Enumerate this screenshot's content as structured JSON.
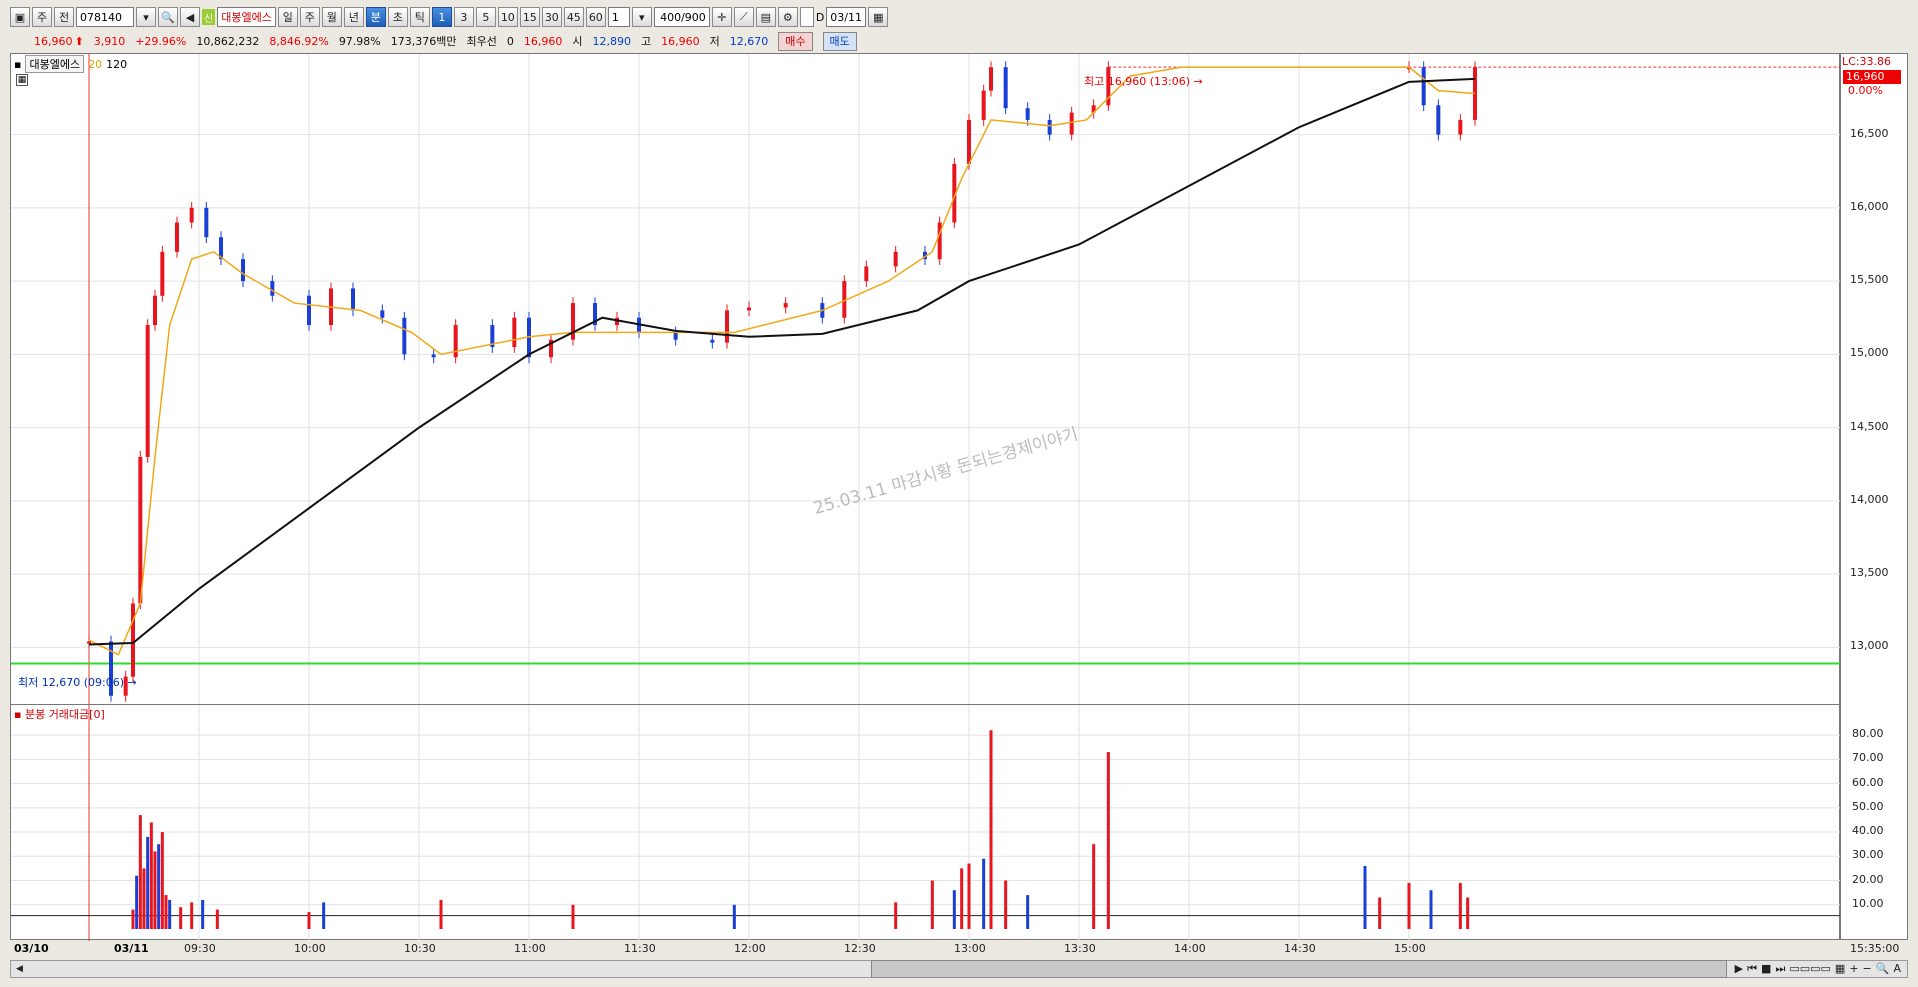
{
  "toolbar": {
    "type_label": "주",
    "prefix": "전",
    "code": "078140",
    "shin": "신",
    "name": "대봉엘에스",
    "period_day": "일",
    "period_week": "주",
    "period_month": "월",
    "period_year": "년",
    "period_min": "분",
    "period_sec": "초",
    "period_tick": "틱",
    "intervals": [
      "1",
      "3",
      "5",
      "10",
      "15",
      "30",
      "45",
      "60"
    ],
    "interval_value": "1",
    "count": "400/900",
    "check_label": "D",
    "date": "03/11"
  },
  "quote": {
    "price": "16,960",
    "change": "3,910",
    "change_pct": "+29.96%",
    "volume": "10,862,232",
    "vol_ratio": "8,846.92%",
    "pct2": "97.98%",
    "amount": "173,376백만",
    "best_label": "최우선",
    "best_value": "0",
    "best_price": "16,960",
    "open_label": "시",
    "open": "12,890",
    "high_label": "고",
    "high": "16,960",
    "low_label": "저",
    "low": "12,670",
    "buy": "매수",
    "sell": "매도"
  },
  "legend": {
    "name": "대봉엘에스",
    "ma20": "20",
    "ma120": "120"
  },
  "annotations": {
    "high": "최고 16,960 (13:06) →",
    "low": "최저 12,670 (09:06) →",
    "lc": "LC:33.86",
    "last": "16,960",
    "pct": "0.00%",
    "watermark": "25.03.11 마감시황 돈되는경제이야기",
    "volume_title": "분봉 거래대금[0]"
  },
  "price_axis": [
    "16,500",
    "16,000",
    "15,500",
    "15,000",
    "14,500",
    "14,000",
    "13,500",
    "13,000"
  ],
  "volume_axis": [
    "80.00",
    "70.00",
    "60.00",
    "50.00",
    "40.00",
    "30.00",
    "20.00",
    "10.00"
  ],
  "time_axis": [
    "09:30",
    "10:00",
    "10:30",
    "11:00",
    "11:30",
    "12:00",
    "12:30",
    "13:00",
    "13:30",
    "14:00",
    "14:30",
    "15:00",
    "15:35:00"
  ],
  "dates": [
    "03/10",
    "03/11"
  ],
  "chart_data": {
    "type": "candlestick",
    "ylim": [
      12600,
      17050
    ],
    "support_line": 12890,
    "price": [
      {
        "t": "09:00",
        "c": 13040
      },
      {
        "t": "09:06",
        "c": 12670
      },
      {
        "t": "09:10",
        "c": 12800
      },
      {
        "t": "09:12",
        "c": 13300
      },
      {
        "t": "09:14",
        "c": 14300
      },
      {
        "t": "09:16",
        "c": 15200
      },
      {
        "t": "09:18",
        "c": 15400
      },
      {
        "t": "09:20",
        "c": 15700
      },
      {
        "t": "09:24",
        "c": 15900
      },
      {
        "t": "09:28",
        "c": 16000
      },
      {
        "t": "09:32",
        "c": 15800
      },
      {
        "t": "09:36",
        "c": 15650
      },
      {
        "t": "09:42",
        "c": 15500
      },
      {
        "t": "09:50",
        "c": 15400
      },
      {
        "t": "10:00",
        "c": 15200
      },
      {
        "t": "10:06",
        "c": 15450
      },
      {
        "t": "10:12",
        "c": 15300
      },
      {
        "t": "10:20",
        "c": 15250
      },
      {
        "t": "10:26",
        "c": 15000
      },
      {
        "t": "10:34",
        "c": 14980
      },
      {
        "t": "10:40",
        "c": 15200
      },
      {
        "t": "10:50",
        "c": 15050
      },
      {
        "t": "10:56",
        "c": 15250
      },
      {
        "t": "11:00",
        "c": 14980
      },
      {
        "t": "11:06",
        "c": 15100
      },
      {
        "t": "11:12",
        "c": 15350
      },
      {
        "t": "11:18",
        "c": 15200
      },
      {
        "t": "11:24",
        "c": 15250
      },
      {
        "t": "11:30",
        "c": 15150
      },
      {
        "t": "11:40",
        "c": 15100
      },
      {
        "t": "11:50",
        "c": 15080
      },
      {
        "t": "11:54",
        "c": 15300
      },
      {
        "t": "12:00",
        "c": 15320
      },
      {
        "t": "12:10",
        "c": 15350
      },
      {
        "t": "12:20",
        "c": 15250
      },
      {
        "t": "12:26",
        "c": 15500
      },
      {
        "t": "12:32",
        "c": 15600
      },
      {
        "t": "12:40",
        "c": 15700
      },
      {
        "t": "12:48",
        "c": 15650
      },
      {
        "t": "12:52",
        "c": 15900
      },
      {
        "t": "12:56",
        "c": 16300
      },
      {
        "t": "13:00",
        "c": 16600
      },
      {
        "t": "13:04",
        "c": 16800
      },
      {
        "t": "13:06",
        "c": 16960
      },
      {
        "t": "13:10",
        "c": 16680
      },
      {
        "t": "13:16",
        "c": 16600
      },
      {
        "t": "13:22",
        "c": 16500
      },
      {
        "t": "13:28",
        "c": 16650
      },
      {
        "t": "13:34",
        "c": 16700
      },
      {
        "t": "13:38",
        "c": 16960
      },
      {
        "t": "15:00",
        "c": 16960
      },
      {
        "t": "15:04",
        "c": 16700
      },
      {
        "t": "15:08",
        "c": 16500
      },
      {
        "t": "15:14",
        "c": 16600
      },
      {
        "t": "15:18",
        "c": 16960
      }
    ],
    "ma20": [
      {
        "t": "09:00",
        "v": 13050
      },
      {
        "t": "09:08",
        "v": 12950
      },
      {
        "t": "09:14",
        "v": 13300
      },
      {
        "t": "09:18",
        "v": 14300
      },
      {
        "t": "09:22",
        "v": 15200
      },
      {
        "t": "09:28",
        "v": 15650
      },
      {
        "t": "09:34",
        "v": 15700
      },
      {
        "t": "09:42",
        "v": 15550
      },
      {
        "t": "09:56",
        "v": 15350
      },
      {
        "t": "10:14",
        "v": 15300
      },
      {
        "t": "10:28",
        "v": 15150
      },
      {
        "t": "10:36",
        "v": 15000
      },
      {
        "t": "11:00",
        "v": 15120
      },
      {
        "t": "11:12",
        "v": 15150
      },
      {
        "t": "11:40",
        "v": 15150
      },
      {
        "t": "11:56",
        "v": 15150
      },
      {
        "t": "12:20",
        "v": 15300
      },
      {
        "t": "12:38",
        "v": 15500
      },
      {
        "t": "12:50",
        "v": 15700
      },
      {
        "t": "12:58",
        "v": 16200
      },
      {
        "t": "13:06",
        "v": 16600
      },
      {
        "t": "13:22",
        "v": 16560
      },
      {
        "t": "13:32",
        "v": 16600
      },
      {
        "t": "13:44",
        "v": 16900
      },
      {
        "t": "13:58",
        "v": 16960
      },
      {
        "t": "15:00",
        "v": 16960
      },
      {
        "t": "15:08",
        "v": 16800
      },
      {
        "t": "15:18",
        "v": 16780
      }
    ],
    "ma120": [
      {
        "t": "09:00",
        "v": 13020
      },
      {
        "t": "09:12",
        "v": 13030
      },
      {
        "t": "09:30",
        "v": 13400
      },
      {
        "t": "10:00",
        "v": 13950
      },
      {
        "t": "10:30",
        "v": 14500
      },
      {
        "t": "11:00",
        "v": 15000
      },
      {
        "t": "11:20",
        "v": 15250
      },
      {
        "t": "11:40",
        "v": 15160
      },
      {
        "t": "12:00",
        "v": 15120
      },
      {
        "t": "12:20",
        "v": 15140
      },
      {
        "t": "12:46",
        "v": 15300
      },
      {
        "t": "13:00",
        "v": 15500
      },
      {
        "t": "13:30",
        "v": 15750
      },
      {
        "t": "14:00",
        "v": 16150
      },
      {
        "t": "14:30",
        "v": 16550
      },
      {
        "t": "15:00",
        "v": 16860
      },
      {
        "t": "15:18",
        "v": 16880
      }
    ],
    "volume": {
      "ylim": [
        0,
        85
      ],
      "bars": [
        {
          "t": "09:12",
          "v": 8
        },
        {
          "t": "09:13",
          "v": 22
        },
        {
          "t": "09:14",
          "v": 47
        },
        {
          "t": "09:15",
          "v": 25
        },
        {
          "t": "09:16",
          "v": 38
        },
        {
          "t": "09:17",
          "v": 44
        },
        {
          "t": "09:18",
          "v": 32
        },
        {
          "t": "09:19",
          "v": 35
        },
        {
          "t": "09:20",
          "v": 40
        },
        {
          "t": "09:21",
          "v": 14
        },
        {
          "t": "09:22",
          "v": 12
        },
        {
          "t": "09:25",
          "v": 9
        },
        {
          "t": "09:28",
          "v": 11
        },
        {
          "t": "09:31",
          "v": 12
        },
        {
          "t": "09:35",
          "v": 8
        },
        {
          "t": "10:00",
          "v": 7
        },
        {
          "t": "10:04",
          "v": 11
        },
        {
          "t": "10:36",
          "v": 12
        },
        {
          "t": "11:12",
          "v": 10
        },
        {
          "t": "11:56",
          "v": 10
        },
        {
          "t": "12:40",
          "v": 11
        },
        {
          "t": "12:50",
          "v": 20
        },
        {
          "t": "12:56",
          "v": 16
        },
        {
          "t": "12:58",
          "v": 25
        },
        {
          "t": "13:00",
          "v": 27
        },
        {
          "t": "13:04",
          "v": 29
        },
        {
          "t": "13:06",
          "v": 82
        },
        {
          "t": "13:10",
          "v": 20
        },
        {
          "t": "13:16",
          "v": 14
        },
        {
          "t": "13:34",
          "v": 35
        },
        {
          "t": "13:38",
          "v": 73
        },
        {
          "t": "14:48",
          "v": 26
        },
        {
          "t": "14:52",
          "v": 13
        },
        {
          "t": "15:00",
          "v": 19
        },
        {
          "t": "15:06",
          "v": 16
        },
        {
          "t": "15:14",
          "v": 19
        },
        {
          "t": "15:16",
          "v": 13
        }
      ]
    }
  }
}
